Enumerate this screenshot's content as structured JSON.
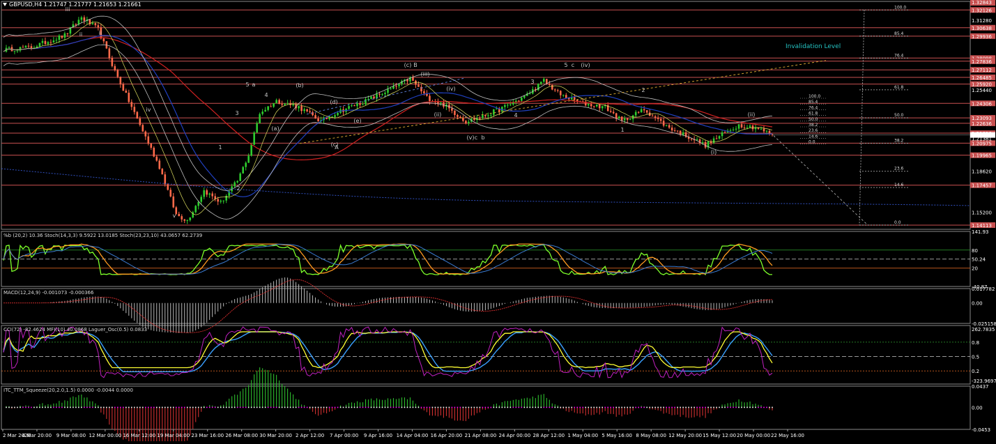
{
  "chart_data": [
    {
      "type": "candlestick",
      "symbol": "GBPUSD",
      "timeframe": "H4",
      "header": "GBPUSD,H4  1.21747 1.21777 1.21653 1.21661",
      "ohlc": {
        "open": 1.21747,
        "high": 1.21777,
        "low": 1.21653,
        "close": 1.21661
      },
      "ylim": [
        1.1376,
        1.32843
      ],
      "y_ticks": [
        "1.32843",
        "1.31280",
        "1.29936",
        "1.28130",
        "1.26800",
        "1.25440",
        "1.24080",
        "1.22720",
        "1.21381",
        "1.20000",
        "1.18620",
        "1.17260",
        "1.15200",
        "1.13760"
      ],
      "price_levels": [
        {
          "value": 1.32126,
          "label": "1.32126",
          "color": "#c85050"
        },
        {
          "value": 1.30638,
          "label": "1.30638",
          "color": "#c85050"
        },
        {
          "value": 1.29936,
          "label": "1.29936",
          "color": "#c85050"
        },
        {
          "value": 1.28098,
          "label": "1.28098",
          "color": "#c85050"
        },
        {
          "value": 1.27836,
          "label": "1.27836",
          "color": "#c85050"
        },
        {
          "value": 1.27112,
          "label": "1.27112",
          "color": "#c85050"
        },
        {
          "value": 1.26485,
          "label": "1.26485",
          "color": "#c85050"
        },
        {
          "value": 1.2592,
          "label": "1.25920",
          "color": "#c85050"
        },
        {
          "value": 1.24306,
          "label": "1.24306",
          "color": "#c85050"
        },
        {
          "value": 1.23093,
          "label": "1.23093",
          "color": "#c85050"
        },
        {
          "value": 1.22636,
          "label": "1.22636",
          "color": "#c85050"
        },
        {
          "value": 1.2181,
          "label": "1.21810",
          "color": "#c85050"
        },
        {
          "value": 1.20975,
          "label": "1.20975",
          "color": "#c85050"
        },
        {
          "value": 1.19965,
          "label": "1.19965",
          "color": "#c85050"
        },
        {
          "value": 1.17457,
          "label": "1.17457",
          "color": "#c85050"
        },
        {
          "value": 1.14113,
          "label": "1.14113",
          "color": "#c85050"
        }
      ],
      "current_price": {
        "value": 1.21661,
        "label": "1.21661"
      },
      "top_price_label": "1.32843",
      "fib_retracement": [
        {
          "ratio": "100.0",
          "price": 1.32126
        },
        {
          "ratio": "85.4",
          "price": 1.29936
        },
        {
          "ratio": "76.4",
          "price": 1.28098
        },
        {
          "ratio": "61.8",
          "price": 1.2544
        },
        {
          "ratio": "50.0",
          "price": 1.23093
        },
        {
          "ratio": "38.2",
          "price": 1.20975
        },
        {
          "ratio": "23.6",
          "price": 1.1862
        },
        {
          "ratio": "14.6",
          "price": 1.1726
        },
        {
          "ratio": "0.0",
          "price": 1.14113
        }
      ],
      "small_fib": [
        "100.0",
        "85.4",
        "76.4",
        "61.8",
        "50.0",
        "38.2",
        "23.6",
        "14.6",
        "0.0"
      ],
      "annotation": "Invalidation Level",
      "wave_labels": [
        "i",
        "ii",
        "iii",
        "iv",
        "v",
        "1",
        "2",
        "3",
        "4",
        "5",
        "a",
        "b",
        "c",
        "(a)",
        "(b)",
        "(c)",
        "(i)",
        "(ii)",
        "(iii)",
        "(iv)",
        "(v)",
        "A",
        "B",
        "C"
      ],
      "x_labels": [
        "2 Mar 2020",
        "4 Mar 20:00",
        "9 Mar 08:00",
        "12 Mar 00:00",
        "16 Mar 12:00",
        "19 Mar 04:00",
        "23 Mar 16:00",
        "26 Mar 08:00",
        "30 Mar 20:00",
        "2 Apr 12:00",
        "7 Apr 00:00",
        "9 Apr 16:00",
        "14 Apr 04:00",
        "16 Apr 20:00",
        "21 Apr 08:00",
        "24 Apr 00:00",
        "28 Apr 12:00",
        "1 May 04:00",
        "5 May 16:00",
        "8 May 08:00",
        "12 May 20:00",
        "15 May 12:00",
        "20 May 00:00",
        "22 May 16:00"
      ],
      "key_path": [
        [
          0,
          1.288
        ],
        [
          10,
          1.29
        ],
        [
          22,
          1.3
        ],
        [
          28,
          1.315
        ],
        [
          34,
          1.305
        ],
        [
          40,
          1.27
        ],
        [
          48,
          1.23
        ],
        [
          56,
          1.19
        ],
        [
          62,
          1.15
        ],
        [
          66,
          1.145
        ],
        [
          72,
          1.17
        ],
        [
          78,
          1.16
        ],
        [
          84,
          1.178
        ],
        [
          88,
          1.2
        ],
        [
          92,
          1.235
        ],
        [
          98,
          1.245
        ],
        [
          106,
          1.24
        ],
        [
          114,
          1.228
        ],
        [
          120,
          1.236
        ],
        [
          130,
          1.245
        ],
        [
          140,
          1.256
        ],
        [
          146,
          1.264
        ],
        [
          152,
          1.248
        ],
        [
          158,
          1.242
        ],
        [
          166,
          1.228
        ],
        [
          172,
          1.232
        ],
        [
          180,
          1.24
        ],
        [
          188,
          1.25
        ],
        [
          194,
          1.262
        ],
        [
          200,
          1.25
        ],
        [
          208,
          1.243
        ],
        [
          216,
          1.24
        ],
        [
          222,
          1.228
        ],
        [
          230,
          1.238
        ],
        [
          238,
          1.224
        ],
        [
          246,
          1.215
        ],
        [
          252,
          1.208
        ],
        [
          258,
          1.217
        ],
        [
          264,
          1.225
        ],
        [
          270,
          1.223
        ],
        [
          276,
          1.2166
        ]
      ]
    },
    {
      "type": "line",
      "title": "%b (20,2) 10.36  Stoch(14,3,3) 9.5922 13.0185  Stoch(23,23,10) 43.0657 62.2739",
      "y_ticks": [
        "141.93",
        "80",
        "50.24",
        "20",
        "-40.87"
      ],
      "ylim": [
        -40.87,
        141.93
      ]
    },
    {
      "type": "bar",
      "title": "MACD(12,24,9) -0.001073 -0.000366",
      "y_ticks": [
        "0.017782",
        "0.00",
        "-0.025158"
      ],
      "ylim": [
        -0.025158,
        0.017782
      ]
    },
    {
      "type": "line",
      "title": "CCI(72) -82.4624  MFI(10) 40.0868  Laguer_Osc(0.5) 0.0833",
      "y_ticks": [
        "262.7835",
        "0.8",
        "0.5",
        "0.2",
        "-323.9697"
      ],
      "ylim": [
        -323.9697,
        262.7835
      ]
    },
    {
      "type": "bar",
      "title": "ITC_TTM_Squeeze(20,2.0,1.5) 0.0000 -0.0044 0.0000",
      "y_ticks": [
        "0.0437",
        "0.00",
        "-0.0453"
      ],
      "ylim": [
        -0.0453,
        0.0437
      ]
    }
  ],
  "colors": {
    "background": "#000000",
    "bull_candle": "#2ecc2e",
    "bear_candle": "#ff6a4a",
    "level_line": "#c85050",
    "ma_red": "#d02020",
    "ma_blue": "#2040c0",
    "bands": "#c0c0c0",
    "invalid_text": "#25c3c3",
    "stoch_green": "#7dff2a",
    "stoch_orange": "#ff9a20",
    "cci_blue": "#3aa0ff",
    "cci_yellow": "#ffff33",
    "mfi_magenta": "#c020c0",
    "squeeze_green": "#2ebd2e",
    "squeeze_red": "#d03030",
    "squeeze_dots": "#ff00ff"
  }
}
